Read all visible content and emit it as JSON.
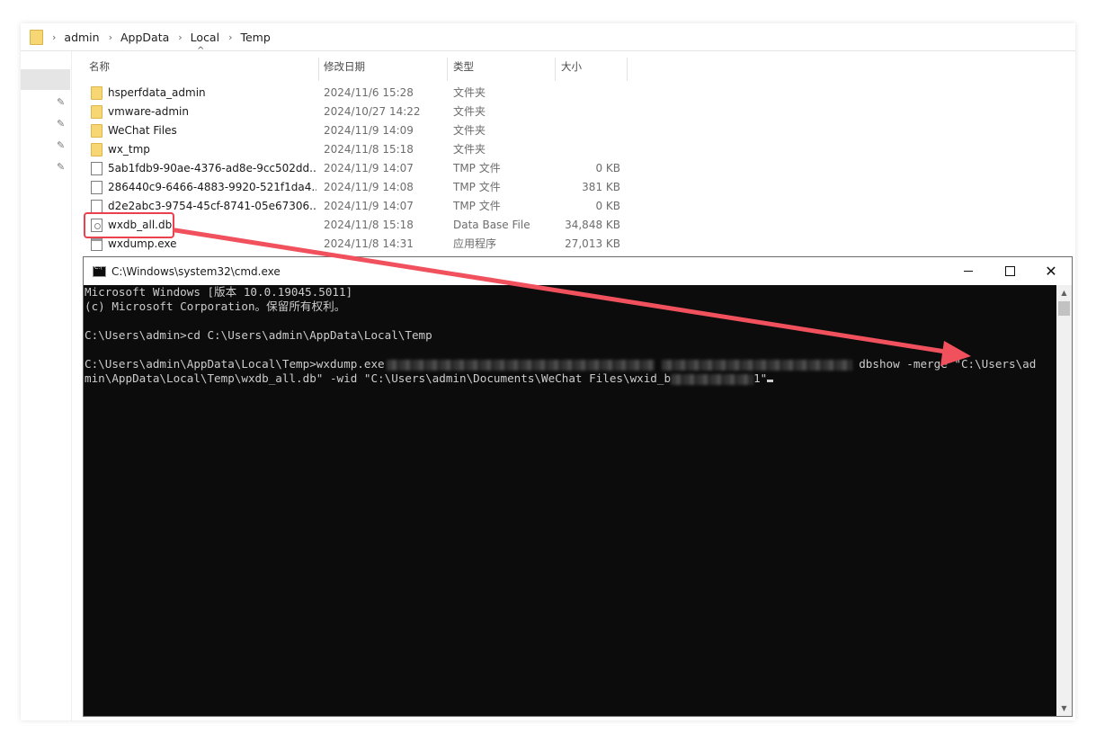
{
  "address_bar": {
    "crumbs": [
      "admin",
      "AppData",
      "Local",
      "Temp"
    ]
  },
  "columns": {
    "name": "名称",
    "modified": "修改日期",
    "type": "类型",
    "size": "大小"
  },
  "files": [
    {
      "name": "hsperfdata_admin",
      "date": "2024/11/6 15:28",
      "type": "文件夹",
      "size": "",
      "icon": "folder-icon"
    },
    {
      "name": "vmware-admin",
      "date": "2024/10/27 14:22",
      "type": "文件夹",
      "size": "",
      "icon": "folder-icon"
    },
    {
      "name": "WeChat Files",
      "date": "2024/11/9 14:09",
      "type": "文件夹",
      "size": "",
      "icon": "folder-icon"
    },
    {
      "name": "wx_tmp",
      "date": "2024/11/8 15:18",
      "type": "文件夹",
      "size": "",
      "icon": "folder-icon"
    },
    {
      "name": "5ab1fdb9-90ae-4376-ad8e-9cc502dd...",
      "date": "2024/11/9 14:07",
      "type": "TMP 文件",
      "size": "0 KB",
      "icon": "file-icon"
    },
    {
      "name": "286440c9-6466-4883-9920-521f1da4...",
      "date": "2024/11/9 14:08",
      "type": "TMP 文件",
      "size": "381 KB",
      "icon": "file-icon"
    },
    {
      "name": "d2e2abc3-9754-45cf-8741-05e67306...",
      "date": "2024/11/9 14:07",
      "type": "TMP 文件",
      "size": "0 KB",
      "icon": "file-icon"
    },
    {
      "name": "wxdb_all.db",
      "date": "2024/11/8 15:18",
      "type": "Data Base File",
      "size": "34,848 KB",
      "icon": "database-file-icon"
    },
    {
      "name": "wxdump.exe",
      "date": "2024/11/8 14:31",
      "type": "应用程序",
      "size": "27,013 KB",
      "icon": "application-icon"
    }
  ],
  "cmd": {
    "title": "C:\\Windows\\system32\\cmd.exe",
    "lines": {
      "l1": "Microsoft Windows [版本 10.0.19045.5011]",
      "l2": "(c) Microsoft Corporation。保留所有权利。",
      "l3": "",
      "l4": "C:\\Users\\admin>cd C:\\Users\\admin\\AppData\\Local\\Temp",
      "l5": "",
      "l6a": "C:\\Users\\admin\\AppData\\Local\\Temp>wxdump.exe",
      "l6b": " dbshow -merge \"C:\\Users\\ad",
      "l7a": "min\\AppData\\Local\\Temp\\wxdb_all.db\" -wid \"C:\\Users\\admin\\Documents\\WeChat Files\\wxid_b",
      "l7b": "1\""
    }
  },
  "colors": {
    "highlight": "#e9424e",
    "arrow": "#f0515d",
    "console_bg": "#0c0c0c",
    "console_text": "#cccccc"
  }
}
